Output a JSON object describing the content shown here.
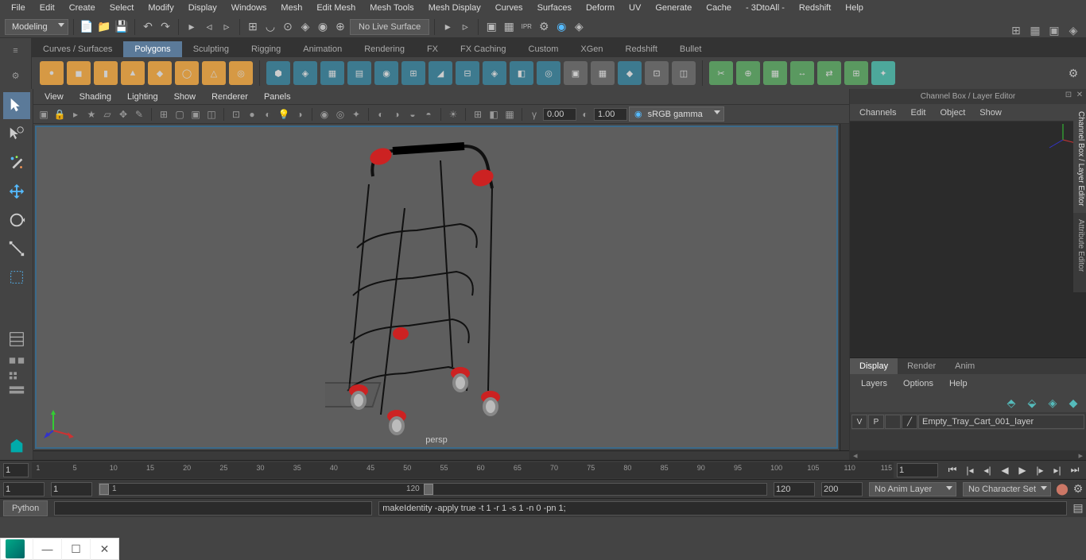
{
  "menubar": [
    "File",
    "Edit",
    "Create",
    "Select",
    "Modify",
    "Display",
    "Windows",
    "Mesh",
    "Edit Mesh",
    "Mesh Tools",
    "Mesh Display",
    "Curves",
    "Surfaces",
    "Deform",
    "UV",
    "Generate",
    "Cache",
    "- 3DtoAll -",
    "Redshift",
    "Help"
  ],
  "workspace": "Modeling",
  "no_live_surface": "No Live Surface",
  "shelf_tabs": [
    "Curves / Surfaces",
    "Polygons",
    "Sculpting",
    "Rigging",
    "Animation",
    "Rendering",
    "FX",
    "FX Caching",
    "Custom",
    "XGen",
    "Redshift",
    "Bullet"
  ],
  "shelf_active": 1,
  "viewport_menus": [
    "View",
    "Shading",
    "Lighting",
    "Show",
    "Renderer",
    "Panels"
  ],
  "vp_val1": "0.00",
  "vp_val2": "1.00",
  "color_space": "sRGB gamma",
  "persp_label": "persp",
  "channel_box": {
    "title": "Channel Box / Layer Editor",
    "menus": [
      "Channels",
      "Edit",
      "Object",
      "Show"
    ],
    "side_tabs": [
      "Channel Box / Layer Editor",
      "Attribute Editor"
    ],
    "layer_tabs": [
      "Display",
      "Render",
      "Anim"
    ],
    "layer_menu": [
      "Layers",
      "Options",
      "Help"
    ],
    "layer_row": {
      "v": "V",
      "p": "P",
      "name": "Empty_Tray_Cart_001_layer"
    }
  },
  "timeline": {
    "start_field": "1",
    "ticks": [
      1,
      5,
      10,
      15,
      20,
      25,
      30,
      35,
      40,
      45,
      50,
      55,
      60,
      65,
      70,
      75,
      80,
      85,
      90,
      95,
      100,
      105,
      110,
      115
    ],
    "current": "1"
  },
  "range": {
    "start": "1",
    "range_start": "1",
    "range_label_start": "1",
    "range_end": "120",
    "end": "120",
    "max": "200",
    "anim_layer": "No Anim Layer",
    "char_set": "No Character Set"
  },
  "cmd": {
    "lang": "Python",
    "output": "makeIdentity -apply true -t 1 -r 1 -s 1 -n 0 -pn 1;"
  }
}
